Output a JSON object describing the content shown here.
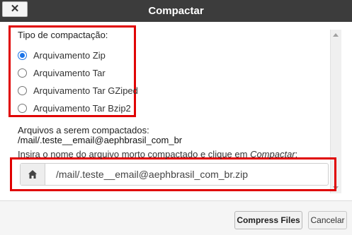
{
  "window": {
    "title": "Compactar",
    "close_label": "✕"
  },
  "compression_type": {
    "label": "Tipo de compactação:",
    "options": [
      {
        "label": "Arquivamento Zip",
        "selected": true
      },
      {
        "label": "Arquivamento Tar",
        "selected": false
      },
      {
        "label": "Arquivamento Tar GZiped",
        "selected": false
      },
      {
        "label": "Arquivamento Tar Bzip2",
        "selected": false
      }
    ]
  },
  "files": {
    "label": "Arquivos a serem compactados:",
    "path": "/mail/.teste__email@aephbrasil_com_br"
  },
  "instruction": {
    "prefix": "Insira o nome do arquivo morto compactado e clique em ",
    "action": "Compactar",
    "suffix": ":"
  },
  "archive_input": {
    "icon": "home-icon",
    "value": "/mail/.teste__email@aephbrasil_com_br.zip"
  },
  "footer": {
    "compress_label": "Compress Files",
    "cancel_label": "Cancelar"
  },
  "colors": {
    "titlebar": "#3c3c3c",
    "highlight": "#e00000",
    "radio_accent": "#1a73e8"
  }
}
